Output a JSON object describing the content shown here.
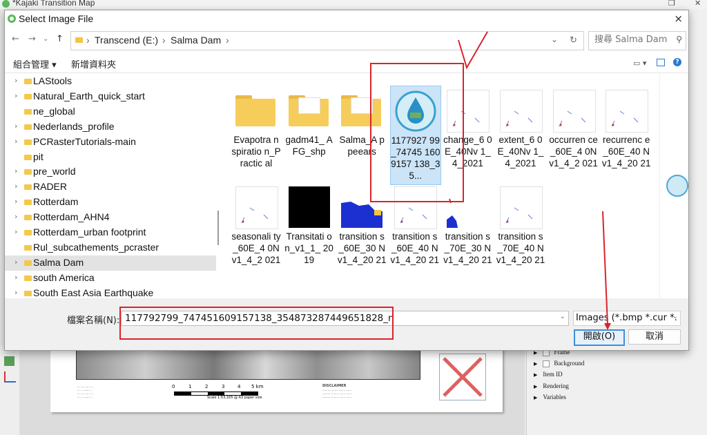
{
  "app": {
    "window_title": "*Kajaki Transition Map"
  },
  "dialog": {
    "title": "Select Image File",
    "close": "×",
    "nav": {
      "back": "←",
      "forward": "→",
      "recent": "⌄",
      "up": "↑"
    },
    "address": {
      "sep1": "›",
      "drive": "Transcend (E:)",
      "sep2": "›",
      "folder": "Salma Dam",
      "sep3": "›",
      "dropdown": "⌄",
      "refresh": "↻"
    },
    "search": {
      "placeholder": "搜尋 Salma Dam",
      "icon": "search-icon"
    },
    "commands": {
      "organize": "組合管理 ▾",
      "new_folder": "新增資料夾",
      "view": "▭ ▾",
      "help": "?"
    },
    "sidebar": [
      {
        "label": "LAStools",
        "chevron": "›",
        "selected": false
      },
      {
        "label": "Natural_Earth_quick_start",
        "chevron": "›",
        "selected": false
      },
      {
        "label": "ne_global",
        "chevron": "",
        "selected": false
      },
      {
        "label": "Nederlands_profile",
        "chevron": "›",
        "selected": false
      },
      {
        "label": "PCRasterTutorials-main",
        "chevron": "›",
        "selected": false
      },
      {
        "label": "pit",
        "chevron": "",
        "selected": false
      },
      {
        "label": "pre_world",
        "chevron": "›",
        "selected": false
      },
      {
        "label": "RADER",
        "chevron": "›",
        "selected": false
      },
      {
        "label": "Rotterdam",
        "chevron": "›",
        "selected": false
      },
      {
        "label": "Rotterdam_AHN4",
        "chevron": "›",
        "selected": false
      },
      {
        "label": "Rotterdam_urban footprint",
        "chevron": "›",
        "selected": false
      },
      {
        "label": "Rul_subcathements_pcraster",
        "chevron": "",
        "selected": false
      },
      {
        "label": "Salma Dam",
        "chevron": "›",
        "selected": true
      },
      {
        "label": "south America",
        "chevron": "›",
        "selected": false
      },
      {
        "label": "South East Asia Earthquake",
        "chevron": "›",
        "selected": false
      }
    ],
    "files": [
      {
        "name": "Evapotra nspiratio n_Practic al",
        "kind": "folder"
      },
      {
        "name": "gadm41_ AFG_shp",
        "kind": "folder-doc"
      },
      {
        "name": "Salma_A ppeears",
        "kind": "folder-doc"
      },
      {
        "name": "1177927 99_74745 1609157 138_35...",
        "kind": "logo",
        "selected": true
      },
      {
        "name": "change_6 0E_40Nv 1_4_2021",
        "kind": "map"
      },
      {
        "name": "extent_6 0E_40Nv 1_4_2021",
        "kind": "map"
      },
      {
        "name": "occurren ce_60E_4 0Nv1_4_2 021",
        "kind": "map"
      },
      {
        "name": "recurrenc e_60E_40 Nv1_4_20 21",
        "kind": "map"
      },
      {
        "name": "seasonali ty_60E_4 0Nv1_4_2 021",
        "kind": "map"
      },
      {
        "name": "Transitati on_v1_1_ 2019",
        "kind": "black"
      },
      {
        "name": "transition s_60E_30 Nv1_4_20 21",
        "kind": "blue"
      },
      {
        "name": "transition s_60E_40 Nv1_4_20 21",
        "kind": "map"
      },
      {
        "name": "transition s_70E_30 Nv1_4_20 21",
        "kind": "blue-small"
      },
      {
        "name": "transition s_70E_40 Nv1_4_20 21",
        "kind": "map"
      }
    ],
    "filename": {
      "label": "檔案名稱(N):",
      "value": "117792799_747451609157138_354873287449651828_n"
    },
    "filter": {
      "value": "Images (*.bmp *.cur *."
    },
    "buttons": {
      "open": "開啟(O)",
      "cancel": "取消"
    }
  },
  "background": {
    "scale_labels": [
      "0",
      "1",
      "2",
      "3",
      "4",
      "5 km"
    ],
    "scale_caption": "Scale 1:53,165 @ A3 paper size",
    "disclaimer_title": "DISCLAIMER",
    "properties": [
      {
        "label": "Frame",
        "checkbox": true
      },
      {
        "label": "Background",
        "checkbox": true
      },
      {
        "label": "Item ID",
        "checkbox": false
      },
      {
        "label": "Rendering",
        "checkbox": false
      },
      {
        "label": "Variables",
        "checkbox": false
      }
    ]
  },
  "colors": {
    "accent": "#3c8ed8",
    "selection": "#cce4f7",
    "annotation": "#d9232a",
    "folder": "#f6cd5b"
  }
}
